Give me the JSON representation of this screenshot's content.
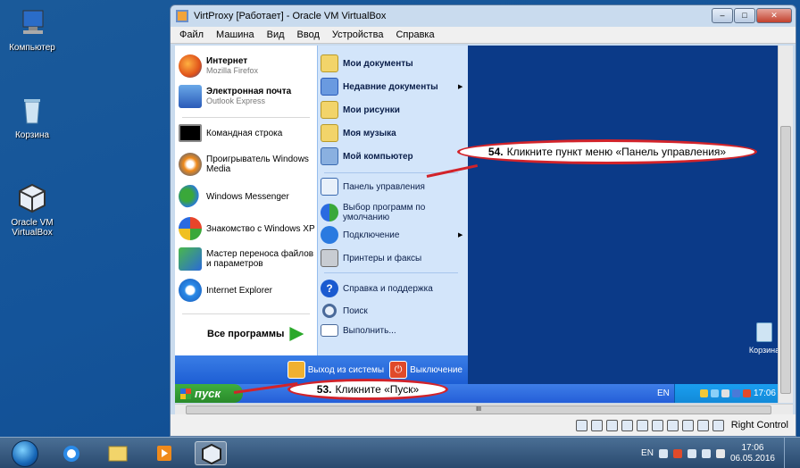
{
  "host_desktop": {
    "icons": [
      {
        "label": "Компьютер"
      },
      {
        "label": "Корзина"
      },
      {
        "label": "Oracle VM VirtualBox"
      }
    ]
  },
  "vbox_window": {
    "title": "VirtProxy [Работает] - Oracle VM VirtualBox",
    "menu": [
      "Файл",
      "Машина",
      "Вид",
      "Ввод",
      "Устройства",
      "Справка"
    ],
    "hscroll_label": "III",
    "status_label": "Right Control"
  },
  "start_menu": {
    "pinned": [
      {
        "title": "Интернет",
        "subtitle": "Mozilla Firefox"
      },
      {
        "title": "Электронная почта",
        "subtitle": "Outlook Express"
      }
    ],
    "recent": [
      "Командная строка",
      "Проигрыватель Windows Media",
      "Windows Messenger",
      "Знакомство с Windows XP",
      "Мастер переноса файлов и параметров",
      "Internet Explorer"
    ],
    "all_programs": "Все программы",
    "places": [
      "Мои документы",
      "Недавние документы",
      "Мои рисунки",
      "Моя музыка",
      "Мой компьютер"
    ],
    "settings": [
      "Панель управления",
      "Выбор программ по умолчанию",
      "Подключение",
      "Принтеры и факсы",
      "Справка и поддержка",
      "Поиск",
      "Выполнить..."
    ],
    "logoff": "Выход из системы",
    "shutdown": "Выключение"
  },
  "guest_taskbar": {
    "start_label": "пуск",
    "lang": "EN",
    "clock": "17:06",
    "recycle_label": "Корзина"
  },
  "annotations": {
    "step54_num": "54.",
    "step54_text": "Кликните пункт меню «Панель управления»",
    "step53_num": "53.",
    "step53_text": "Кликните «Пуск»"
  },
  "host_taskbar": {
    "lang": "EN",
    "time": "17:06",
    "date": "06.05.2016"
  }
}
